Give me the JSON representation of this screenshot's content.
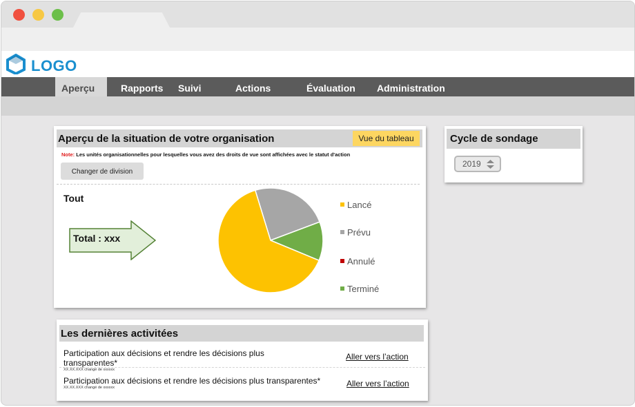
{
  "logo": {
    "text": "LOGO",
    "color": "#1a8fcf"
  },
  "nav": {
    "items": [
      {
        "label": "Aperçu",
        "active": true
      },
      {
        "label": "Rapports"
      },
      {
        "label": "Suivi"
      },
      {
        "label": "Actions"
      },
      {
        "label": "Évaluation"
      },
      {
        "label": "Administration"
      }
    ]
  },
  "overview": {
    "title": "Aperçu de la situation de votre organisation",
    "table_button": "Vue du tableau",
    "note_prefix": "Note:",
    "note_text": "Les unités organisationnelles pour lesquelles vous avez des droits de vue sont affichées avec le statut d'action",
    "division_button": "Changer de division",
    "scope_label": "Tout",
    "total_label": "Total : xxx"
  },
  "chart_data": {
    "type": "pie",
    "slices": [
      {
        "label": "Lancé",
        "value": 64,
        "color": "#fdc201"
      },
      {
        "label": "Prévu",
        "value": 24,
        "color": "#a6a6a6"
      },
      {
        "label": "Annulé",
        "value": 0,
        "color": "#c00000"
      },
      {
        "label": "Terminé",
        "value": 12,
        "color": "#70ad47"
      }
    ],
    "legend_position": "right"
  },
  "activities": {
    "title": "Les dernières activitées",
    "rows": [
      {
        "title": "Participation aux décisions et rendre les décisions plus transparentes*",
        "meta": "XX.XX.XXX changé de xxxxxx",
        "link": "Aller vers l’action"
      },
      {
        "title": "Participation aux décisions et rendre les décisions plus transparentes*",
        "meta": "XX.XX.XXX changé de xxxxxx",
        "link": "Aller vers l’action"
      }
    ]
  },
  "cycle": {
    "title": "Cycle de sondage",
    "year": "2019"
  }
}
